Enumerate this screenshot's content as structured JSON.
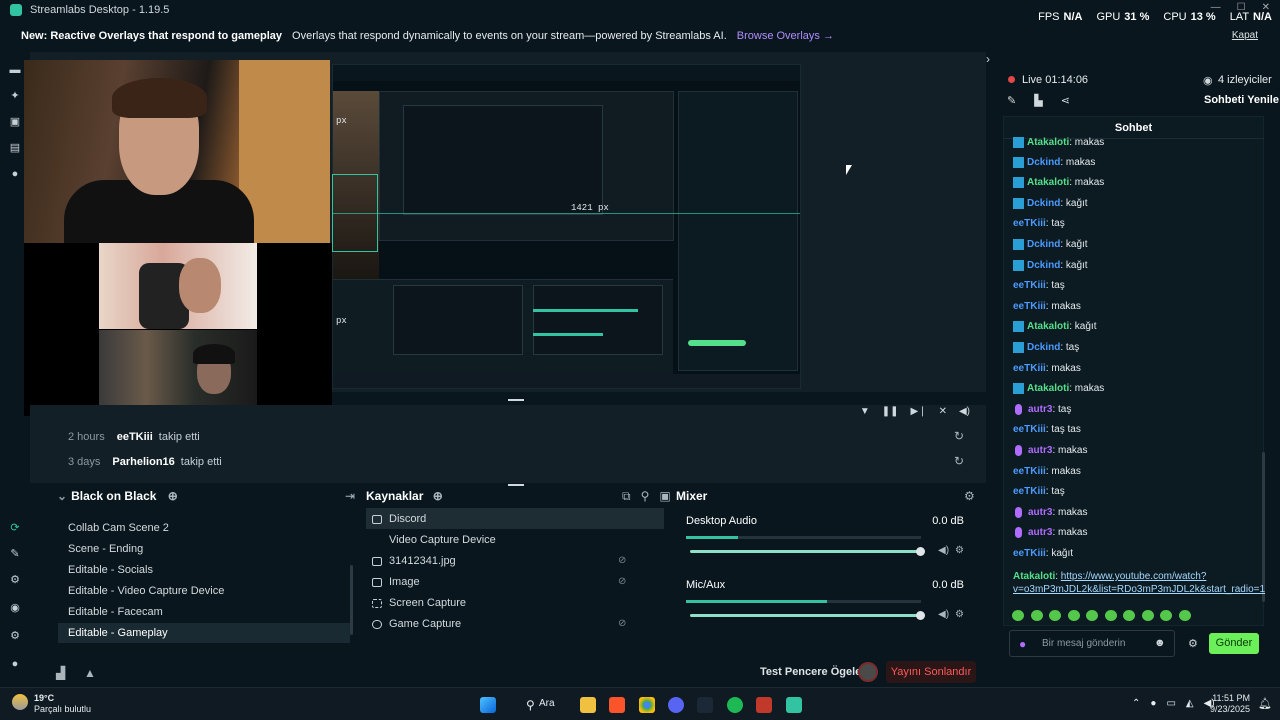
{
  "window": {
    "title": "Streamlabs Desktop - 1.19.5",
    "stats": [
      {
        "label": "FPS",
        "value": "N/A"
      },
      {
        "label": "GPU",
        "value": "31 %"
      },
      {
        "label": "CPU",
        "value": "13 %"
      },
      {
        "label": "LAT",
        "value": "N/A"
      }
    ]
  },
  "banner": {
    "new_label": "New: Reactive Overlays that respond to gameplay",
    "message": "Overlays that respond dynamically to events on your stream—powered by Streamlabs AI.",
    "link": "Browse Overlays →",
    "close": "Kapat"
  },
  "preview": {
    "px_label_a": "px",
    "px_label_b": "1421 px",
    "px_label_c": "px"
  },
  "activity": [
    {
      "time": "2 hours",
      "user": "eeTKiii",
      "action": "takip etti"
    },
    {
      "time": "3 days",
      "user": "Parhelion16",
      "action": "takip etti"
    }
  ],
  "scenes": {
    "title": "Black on Black",
    "items": [
      "Collab Cam Scene 2",
      "Scene - Ending",
      "Editable - Socials",
      "Editable - Video Capture Device",
      "Editable - Facecam",
      "Editable - Gameplay"
    ]
  },
  "sources": {
    "title": "Kaynaklar",
    "items": [
      "Discord",
      "Video Capture Device",
      "31412341.jpg",
      "Image",
      "Screen Capture",
      "Game Capture"
    ]
  },
  "mixer": {
    "title": "Mixer",
    "channels": [
      {
        "name": "Desktop Audio",
        "db": "0.0 dB",
        "level": 0.22,
        "volume": 1.0
      },
      {
        "name": "Mic/Aux",
        "db": "0.0 dB",
        "level": 0.6,
        "volume": 1.0
      }
    ]
  },
  "footer": {
    "test_label": "Test Pencere Ögeleri",
    "end_button": "Yayını Sonlandır"
  },
  "chat": {
    "live": "Live 01:14:06",
    "viewers": "4 izleyiciler",
    "refresh": "Sohbeti Yenile",
    "title": "Sohbet",
    "messages": [
      {
        "user": "Atakaloti",
        "color": "green",
        "text": "makas"
      },
      {
        "user": "Dckind",
        "color": "dk",
        "text": "makas"
      },
      {
        "user": "Atakaloti",
        "color": "green",
        "text": "makas"
      },
      {
        "user": "Dckind",
        "color": "dk",
        "text": "kağıt"
      },
      {
        "user": "eeTKiii",
        "color": "blue",
        "text": "taş"
      },
      {
        "user": "Dckind",
        "color": "dk",
        "text": "kağıt"
      },
      {
        "user": "Dckind",
        "color": "dk",
        "text": "kağıt"
      },
      {
        "user": "eeTKiii",
        "color": "blue",
        "text": "taş"
      },
      {
        "user": "eeTKiii",
        "color": "blue",
        "text": "makas"
      },
      {
        "user": "Atakaloti",
        "color": "green",
        "text": "kağıt"
      },
      {
        "user": "Dckind",
        "color": "dk",
        "text": "taş"
      },
      {
        "user": "eeTKiii",
        "color": "blue",
        "text": "makas"
      },
      {
        "user": "Atakaloti",
        "color": "green",
        "text": "makas"
      },
      {
        "user": "autr3",
        "color": "purple",
        "text": "taş"
      },
      {
        "user": "eeTKiii",
        "color": "blue",
        "text": "taş tas"
      },
      {
        "user": "autr3",
        "color": "purple",
        "text": "makas"
      },
      {
        "user": "eeTKiii",
        "color": "blue",
        "text": "makas"
      },
      {
        "user": "eeTKiii",
        "color": "blue",
        "text": "taş"
      },
      {
        "user": "autr3",
        "color": "purple",
        "text": "makas"
      },
      {
        "user": "autr3",
        "color": "purple",
        "text": "makas"
      },
      {
        "user": "eeTKiii",
        "color": "blue",
        "text": "kağıt"
      }
    ],
    "link_message": {
      "user": "Atakaloti",
      "url": "https://www.youtube.com/watch?v=o3mP3mJDL2k&list=RDo3mP3mJDL2k&start_radio=1"
    },
    "input_placeholder": "Bir mesaj gönderin",
    "send": "Gönder"
  },
  "taskbar": {
    "weather_temp": "19°C",
    "weather_desc": "Parçalı bulutlu",
    "search": "Ara",
    "time": "11:51 PM",
    "date": "9/23/2025"
  }
}
